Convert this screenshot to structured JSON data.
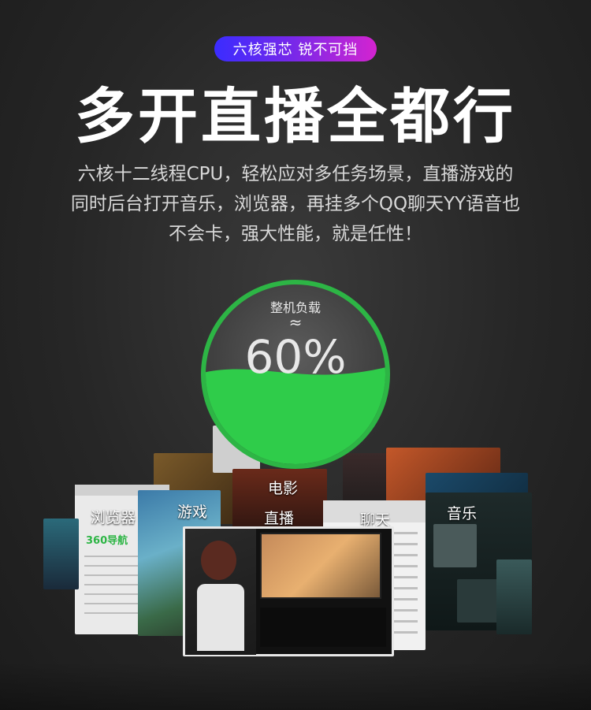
{
  "badge": {
    "text": "六核强芯 锐不可挡"
  },
  "headline": "多开直播全都行",
  "description": {
    "line1": "六核十二线程CPU，轻松应对多任务场景，直播游戏的",
    "line2": "同时后台打开音乐，浏览器，再挂多个QQ聊天YY语音也",
    "line3": "不会卡，强大性能，就是任性！"
  },
  "gauge": {
    "title": "整机负载",
    "approx": "≈",
    "value_text": "60%",
    "fill_fraction": 0.6,
    "color": "#2db545"
  },
  "windows": {
    "browser": "浏览器",
    "browser_brand": "360导航",
    "game": "游戏",
    "movie": "电影",
    "live": "直播",
    "chat": "聊天",
    "music": "音乐"
  },
  "colors": {
    "badge_start": "#3a2cff",
    "badge_end": "#d424d0",
    "accent_green": "#2db545"
  }
}
